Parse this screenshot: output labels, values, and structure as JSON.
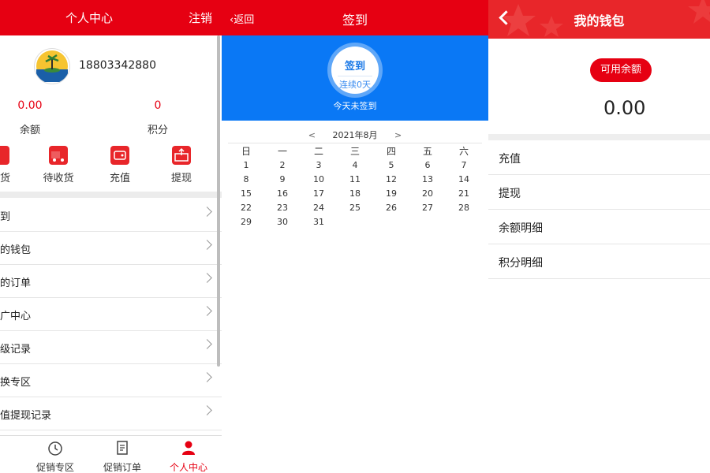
{
  "personal": {
    "title": "个人中心",
    "logout": "注销",
    "phone": "18803342880",
    "balance_value": "0.00",
    "balance_label": "余额",
    "points_value": "0",
    "points_label": "积分",
    "quick_actions": [
      {
        "label": "发货",
        "icon": "truck-icon"
      },
      {
        "label": "待收货",
        "icon": "truck-icon"
      },
      {
        "label": "充值",
        "icon": "wallet-icon"
      },
      {
        "label": "提现",
        "icon": "withdraw-icon"
      }
    ],
    "menu": [
      "签到",
      "我的钱包",
      "我的订单",
      "推广中心",
      "升级记录",
      "兑换专区",
      "充值提现记录"
    ],
    "tabs": [
      {
        "label": "促销专区",
        "icon": "clock-icon"
      },
      {
        "label": "促销订单",
        "icon": "order-icon"
      },
      {
        "label": "个人中心",
        "icon": "person-icon"
      }
    ],
    "accent": "#e60012"
  },
  "checkin": {
    "back": "返回",
    "title": "签到",
    "button": "签到",
    "streak": "连续0天",
    "notice": "今天未签到",
    "month": "2021年8月",
    "prev": "<",
    "next": ">",
    "weekdays": [
      "日",
      "一",
      "二",
      "三",
      "四",
      "五",
      "六"
    ],
    "weeks": [
      [
        "1",
        "2",
        "3",
        "4",
        "5",
        "6",
        "7"
      ],
      [
        "8",
        "9",
        "10",
        "11",
        "12",
        "13",
        "14"
      ],
      [
        "15",
        "16",
        "17",
        "18",
        "19",
        "20",
        "21"
      ],
      [
        "22",
        "23",
        "24",
        "25",
        "26",
        "27",
        "28"
      ],
      [
        "29",
        "30",
        "31",
        "",
        "",
        "",
        ""
      ]
    ],
    "banner_color": "#0a78f5"
  },
  "wallet": {
    "title": "我的钱包",
    "available_label": "可用余额",
    "balance": "0.00",
    "rows": [
      "充值",
      "提现",
      "余额明细",
      "积分明细"
    ]
  }
}
